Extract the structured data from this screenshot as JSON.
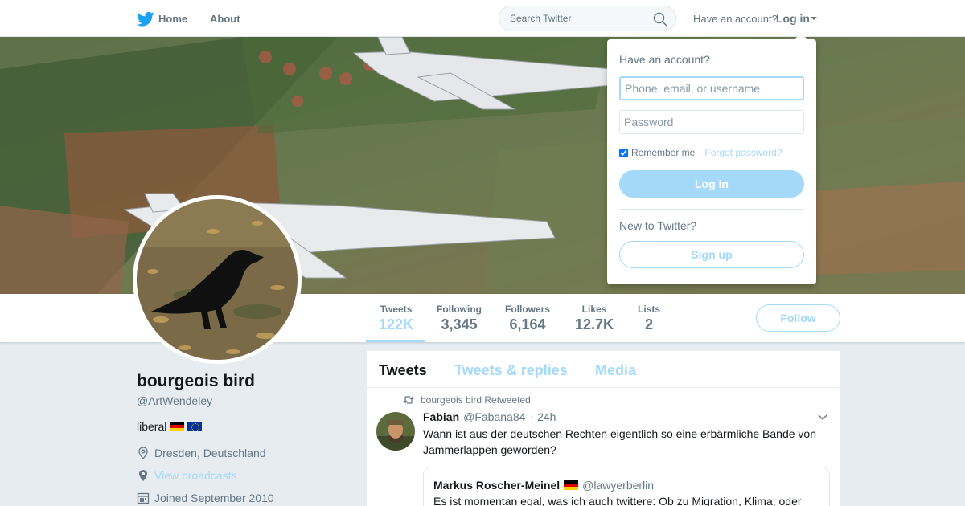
{
  "nav": {
    "home_label": "Home",
    "about_label": "About",
    "search_placeholder": "Search Twitter",
    "have_account": "Have an account?",
    "login_label": "Log in"
  },
  "profile": {
    "name": "bourgeois bird",
    "handle": "@ArtWendeley",
    "bio": "liberal",
    "location": "Dresden, Deutschland",
    "broadcasts_link": "View broadcasts",
    "joined": "Joined September 2010"
  },
  "stats": [
    {
      "label": "Tweets",
      "value": "122K",
      "active": true
    },
    {
      "label": "Following",
      "value": "3,345"
    },
    {
      "label": "Followers",
      "value": "6,164"
    },
    {
      "label": "Likes",
      "value": "12.7K"
    },
    {
      "label": "Lists",
      "value": "2"
    }
  ],
  "follow_label": "Follow",
  "tabs": [
    {
      "label": "Tweets",
      "active": true
    },
    {
      "label": "Tweets & replies"
    },
    {
      "label": "Media"
    }
  ],
  "tweet": {
    "retweeted_by": "bourgeois bird Retweeted",
    "author_name": "Fabian",
    "author_handle": "@Fabana84",
    "separator": "·",
    "time": "24h",
    "text": "Wann ist aus der deutschen Rechten eigentlich so eine erbärmliche Bande von Jammerlappen geworden?",
    "quote": {
      "author_name": "Markus Roscher-Meinel",
      "author_handle": "@lawyerberlin",
      "text": "Es ist momentan egal, was ich auch twittere: Ob zu Migration, Klima, oder"
    }
  },
  "login_dropdown": {
    "title": "Have an account?",
    "username_placeholder": "Phone, email, or username",
    "password_placeholder": "Password",
    "remember_label": "Remember me",
    "separator": "·",
    "forgot_label": "Forgot password?",
    "login_button": "Log in",
    "new_label": "New to Twitter?",
    "signup_button": "Sign up"
  },
  "colors": {
    "accent": "#a4d9f9",
    "brand": "#1da1f2",
    "muted_text": "#657786",
    "page_bg": "#e6ecf0"
  }
}
